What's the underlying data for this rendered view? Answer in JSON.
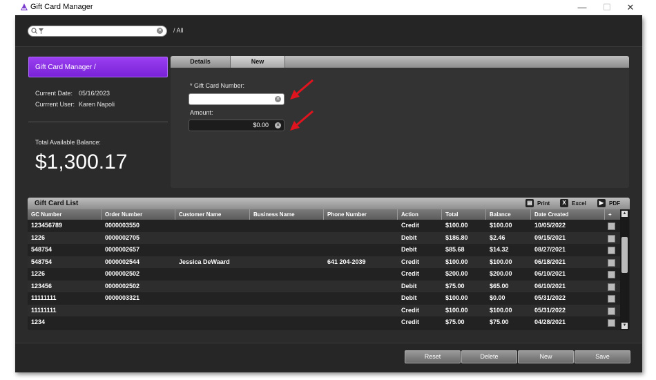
{
  "window": {
    "title": "Gift Card Manager",
    "minimize": "—",
    "maximize": "☐",
    "close": "✕"
  },
  "topbar": {
    "search_placeholder": "",
    "breadcrumb": "/ All"
  },
  "left": {
    "title": "Gift Card Manager /",
    "current_date_label": "Current Date:",
    "current_date": "05/16/2023",
    "current_user_label": "Currrent User:",
    "current_user": "Karen Napoli",
    "balance_label": "Total Available Balance:",
    "balance": "$1,300.17"
  },
  "tabs": {
    "details": "Details",
    "new": "New"
  },
  "form": {
    "gc_number_label": "* Gift Card Number:",
    "gc_number_value": "",
    "amount_label": "Amount:",
    "amount_value": "$0.00"
  },
  "grid": {
    "title": "Gift Card List",
    "exports": {
      "print": "Print",
      "excel": "Excel",
      "pdf": "PDF"
    },
    "columns": [
      "GC Number",
      "Order Number",
      "Customer Name",
      "Business Name",
      "Phone Number",
      "Action",
      "Total",
      "Balance",
      "Date Created"
    ],
    "add_col": "+",
    "rows": [
      [
        "123456789",
        "0000003550",
        "",
        "",
        "",
        "Credit",
        "$100.00",
        "$100.00",
        "10/05/2022"
      ],
      [
        "1226",
        "0000002705",
        "",
        "",
        "",
        "Debit",
        "$186.80",
        "$2.46",
        "09/15/2021"
      ],
      [
        "548754",
        "0000002657",
        "",
        "",
        "",
        "Debit",
        "$85.68",
        "$14.32",
        "08/27/2021"
      ],
      [
        "548754",
        "0000002544",
        "Jessica DeWaard",
        "",
        "641 204-2039",
        "Credit",
        "$100.00",
        "$100.00",
        "06/18/2021"
      ],
      [
        "1226",
        "0000002502",
        "",
        "",
        "",
        "Credit",
        "$200.00",
        "$200.00",
        "06/10/2021"
      ],
      [
        "123456",
        "0000002502",
        "",
        "",
        "",
        "Debit",
        "$75.00",
        "$65.00",
        "06/10/2021"
      ],
      [
        "11111111",
        "0000003321",
        "",
        "",
        "",
        "Debit",
        "$100.00",
        "$0.00",
        "05/31/2022"
      ],
      [
        "11111111",
        "",
        "",
        "",
        "",
        "Credit",
        "$100.00",
        "$100.00",
        "05/31/2022"
      ],
      [
        "1234",
        "",
        "",
        "",
        "",
        "Credit",
        "$75.00",
        "$75.00",
        "04/28/2021"
      ]
    ]
  },
  "buttons": {
    "reset": "Reset",
    "delete": "Delete",
    "new": "New",
    "save": "Save"
  },
  "colors": {
    "accent": "#8a2be2",
    "arrow": "#e0141e"
  }
}
